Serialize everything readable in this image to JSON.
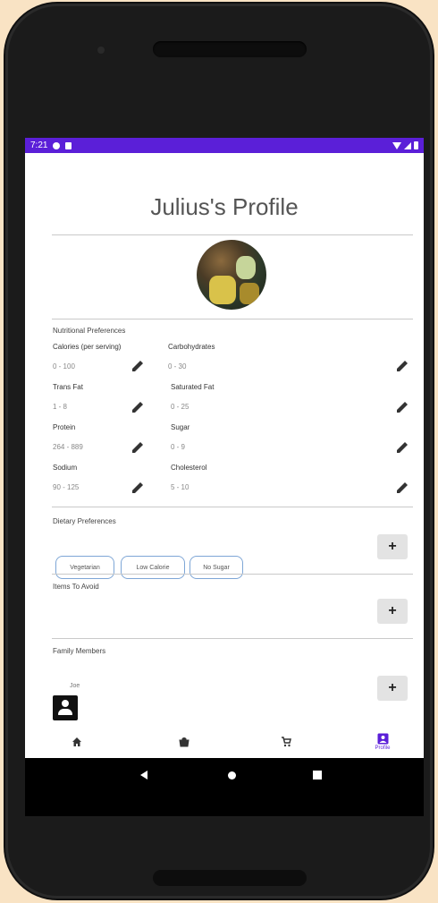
{
  "status_bar": {
    "time": "7:21"
  },
  "profile": {
    "title": "Julius's Profile"
  },
  "nutrition": {
    "heading": "Nutritional Preferences",
    "items": [
      {
        "label": "Calories (per serving)",
        "value": "0 - 100"
      },
      {
        "label": "Carbohydrates",
        "value": "0 - 30"
      },
      {
        "label": "Trans Fat",
        "value": "1 - 8"
      },
      {
        "label": "Saturated Fat",
        "value": "0 - 25"
      },
      {
        "label": "Protein",
        "value": "264 - 889"
      },
      {
        "label": "Sugar",
        "value": "0 - 9"
      },
      {
        "label": "Sodium",
        "value": "90 - 125"
      },
      {
        "label": "Cholesterol",
        "value": "5 - 10"
      }
    ]
  },
  "dietary": {
    "heading": "Dietary Preferences",
    "chips": [
      "Vegetarian",
      "Low Calorie",
      "No Sugar"
    ]
  },
  "avoid": {
    "heading": "Items To Avoid"
  },
  "family": {
    "heading": "Family Members",
    "members": [
      {
        "name": "Joe"
      }
    ]
  },
  "buttons": {
    "add": "+"
  },
  "bottom_nav": {
    "items": [
      {
        "icon": "home-icon"
      },
      {
        "icon": "bag-icon"
      },
      {
        "icon": "cart-icon"
      },
      {
        "icon": "profile-icon",
        "label": "Profile"
      }
    ],
    "active_color": "#5b1fd8"
  },
  "colors": {
    "accent": "#5b1fd8",
    "chip_border": "#7ea6d6"
  }
}
